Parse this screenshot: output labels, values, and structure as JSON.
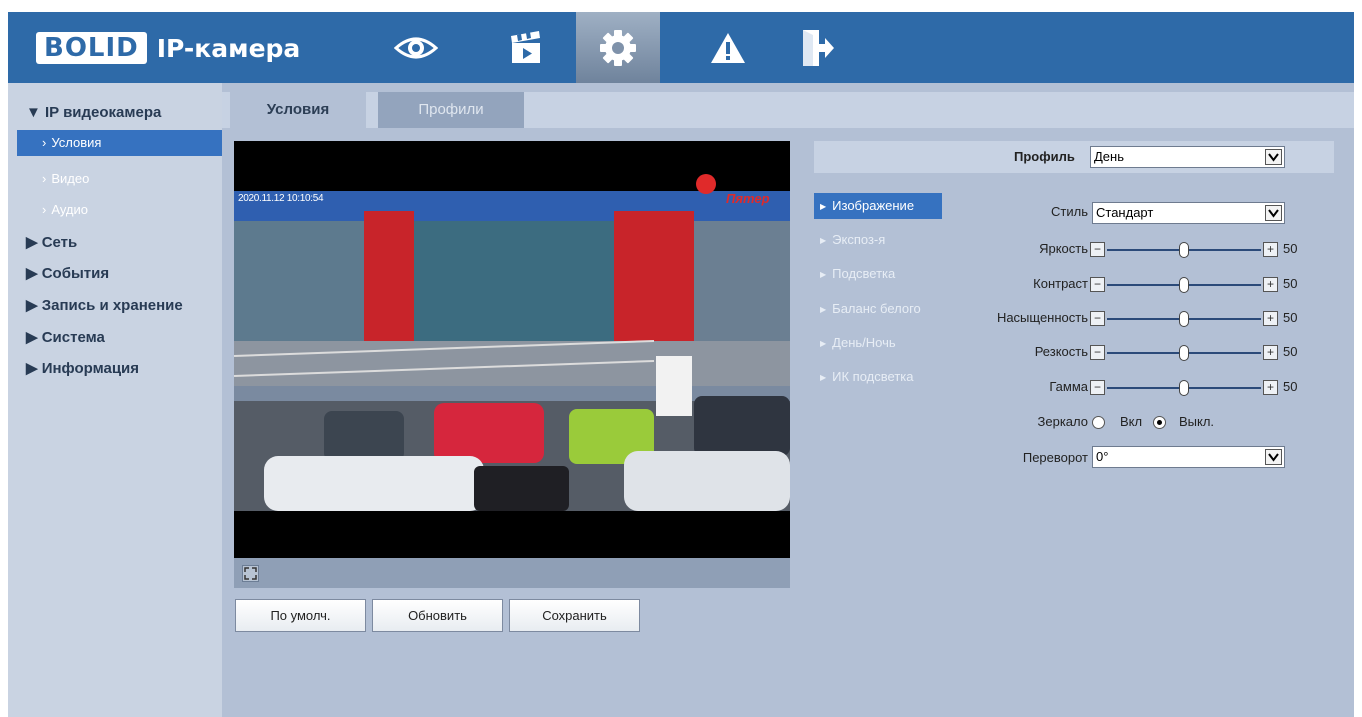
{
  "header": {
    "logo_brand": "BOLID",
    "logo_product": "IP-камера",
    "nav": [
      {
        "icon": "eye-icon",
        "active": false
      },
      {
        "icon": "video-clapper-icon",
        "active": false
      },
      {
        "icon": "gear-icon",
        "active": true
      },
      {
        "icon": "alarm-warning-icon",
        "active": false
      },
      {
        "icon": "logout-icon",
        "active": false
      }
    ]
  },
  "sidebar": {
    "ipcam": "▼ IP видеокамера",
    "ipcam_children": [
      "Условия",
      "Видео",
      "Аудио"
    ],
    "items": [
      "▶ Сеть",
      "▶ События",
      "▶ Запись и хранение",
      "▶ Система",
      "▶ Информация"
    ]
  },
  "tabs": [
    "Условия",
    "Профили"
  ],
  "video": {
    "osd_timestamp": "2020.11.12 10:10:54",
    "store_sign": "Пятер"
  },
  "buttons": {
    "default": "По умолч.",
    "refresh": "Обновить",
    "save": "Сохранить"
  },
  "profile": {
    "label": "Профиль",
    "value": "День"
  },
  "subnav": [
    "Изображение",
    "Экспоз-я",
    "Подсветка",
    "Баланс белого",
    "День/Ночь",
    "ИК подсветка"
  ],
  "settings": {
    "style_label": "Стиль",
    "style_value": "Стандарт",
    "sliders": [
      {
        "label": "Яркость",
        "value": 50
      },
      {
        "label": "Контраст",
        "value": 50
      },
      {
        "label": "Насыщенность",
        "value": 50
      },
      {
        "label": "Резкость",
        "value": 50
      },
      {
        "label": "Гамма",
        "value": 50
      }
    ],
    "mirror_label": "Зеркало",
    "mirror_on": "Вкл",
    "mirror_off": "Выкл.",
    "mirror_selected": "off",
    "flip_label": "Переворот",
    "flip_value": "0°"
  },
  "colors": {
    "header": "#2e6aa8",
    "accent": "#3672c0",
    "panel": "#b3c0d5"
  }
}
